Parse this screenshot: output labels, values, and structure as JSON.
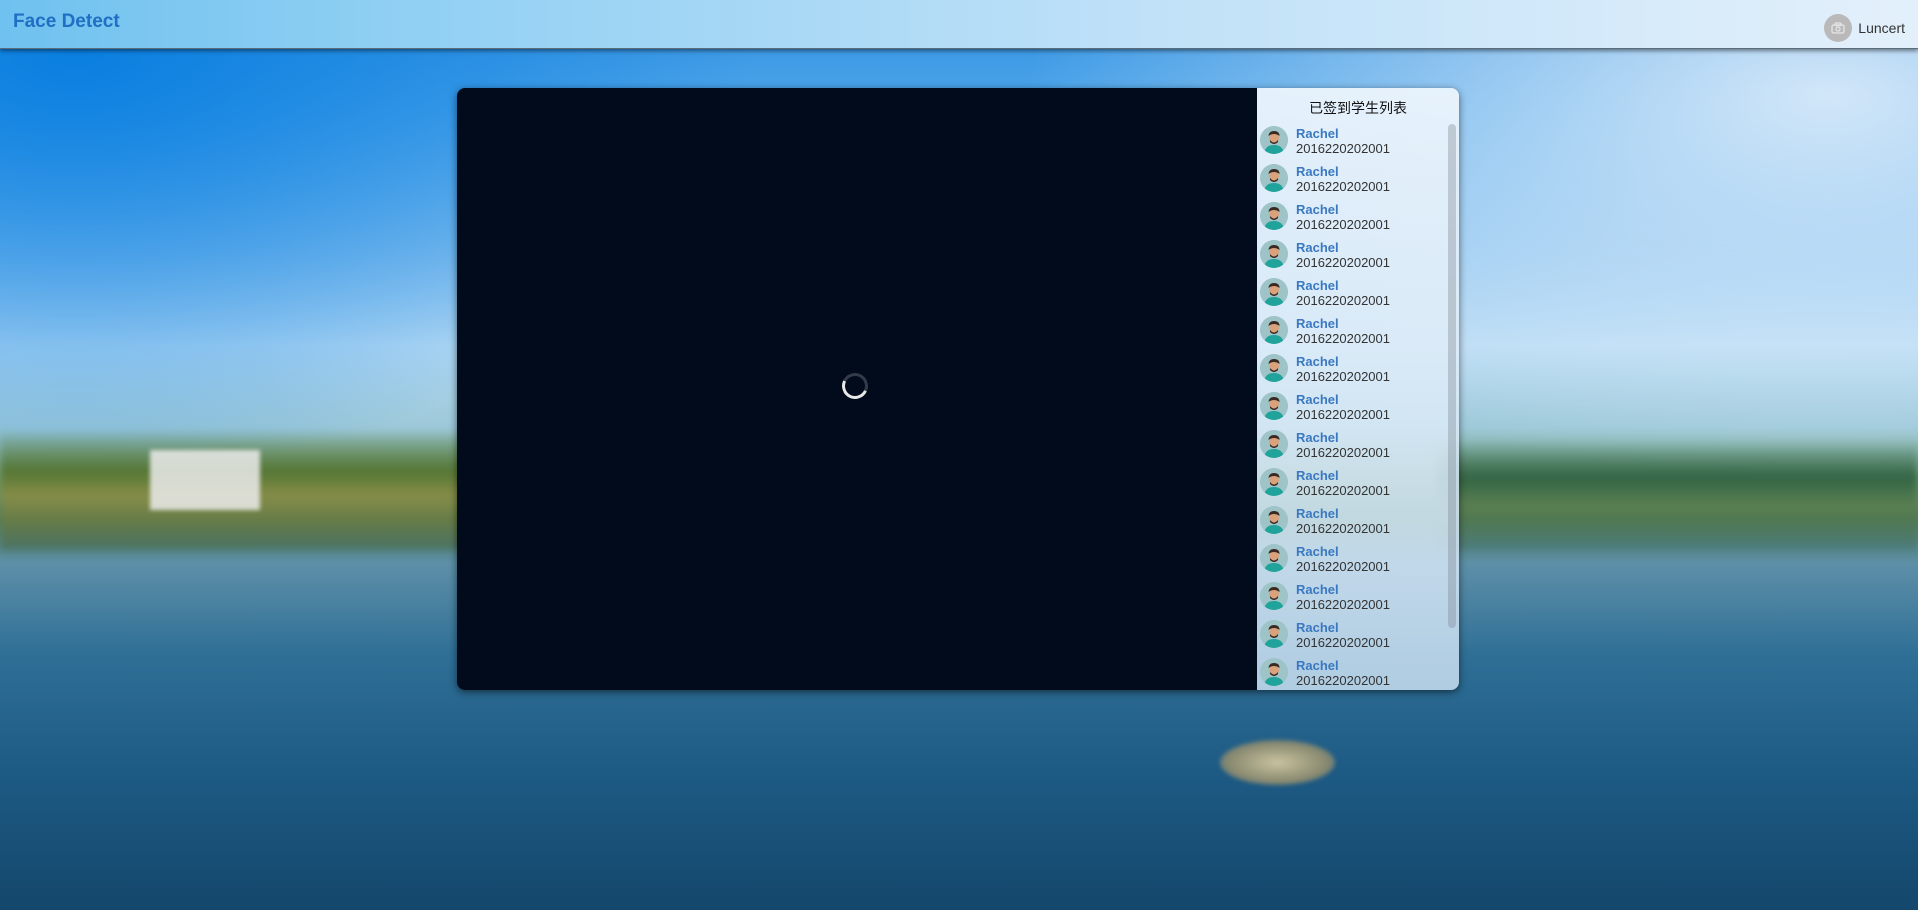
{
  "header": {
    "brand": "Face Detect",
    "user": "Luncert",
    "user_icon": "user-avatar-icon"
  },
  "video": {
    "state": "loading",
    "spinner_icon": "loading-spinner-icon"
  },
  "sidebar": {
    "title": "已签到学生列表",
    "students": [
      {
        "name": "Rachel",
        "id": "2016220202001"
      },
      {
        "name": "Rachel",
        "id": "2016220202001"
      },
      {
        "name": "Rachel",
        "id": "2016220202001"
      },
      {
        "name": "Rachel",
        "id": "2016220202001"
      },
      {
        "name": "Rachel",
        "id": "2016220202001"
      },
      {
        "name": "Rachel",
        "id": "2016220202001"
      },
      {
        "name": "Rachel",
        "id": "2016220202001"
      },
      {
        "name": "Rachel",
        "id": "2016220202001"
      },
      {
        "name": "Rachel",
        "id": "2016220202001"
      },
      {
        "name": "Rachel",
        "id": "2016220202001"
      },
      {
        "name": "Rachel",
        "id": "2016220202001"
      },
      {
        "name": "Rachel",
        "id": "2016220202001"
      },
      {
        "name": "Rachel",
        "id": "2016220202001"
      },
      {
        "name": "Rachel",
        "id": "2016220202001"
      },
      {
        "name": "Rachel",
        "id": "2016220202001"
      }
    ]
  },
  "colors": {
    "brand": "#1f6fc4",
    "student_name": "#3a78c2",
    "video_bg": "#010b1b"
  }
}
